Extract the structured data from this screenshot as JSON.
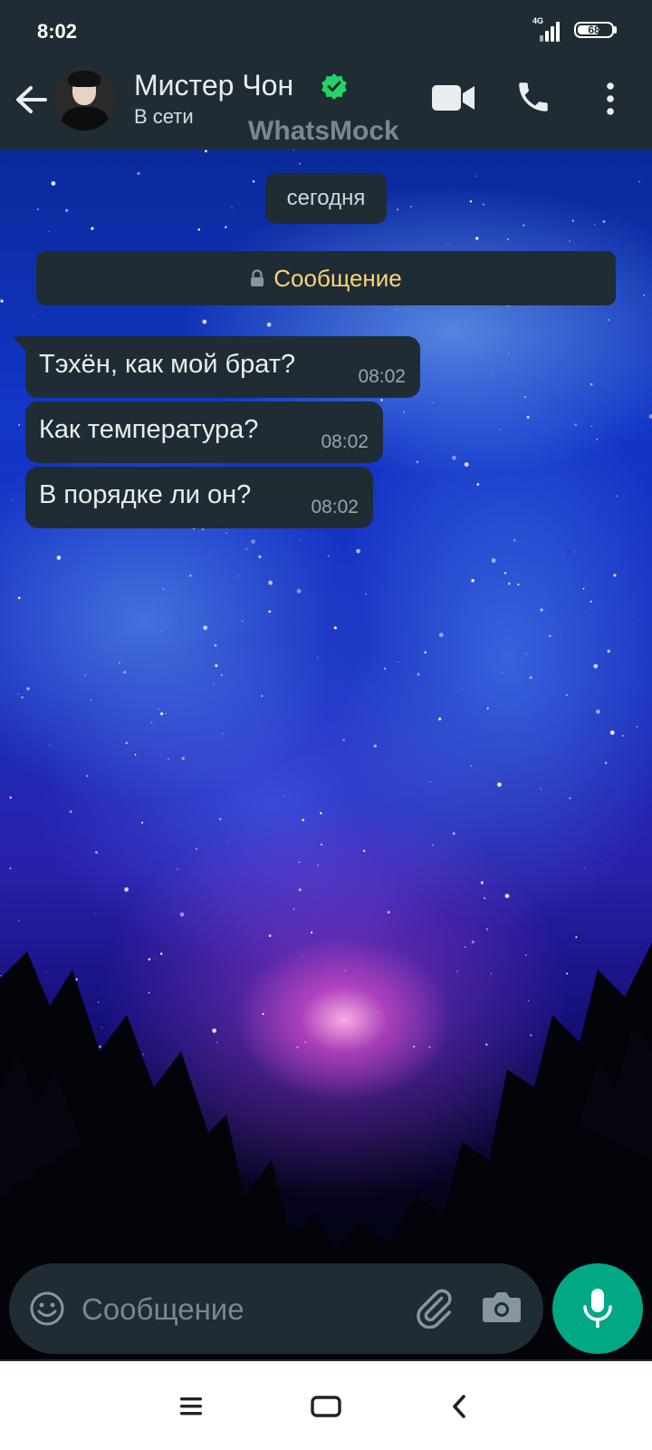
{
  "status_bar": {
    "time": "8:02",
    "network": "4G",
    "battery": "68"
  },
  "header": {
    "contact_name": "Мистер Чон",
    "status": "В сети",
    "watermark": "WhatsMock",
    "verified_color": "#25d366"
  },
  "chat": {
    "date_chip": "сегодня",
    "notice": "Сообщение",
    "messages": [
      {
        "text": "Тэхён, как мой брат?",
        "time": "08:02"
      },
      {
        "text": "Как температура?",
        "time": "08:02"
      },
      {
        "text": "В порядке ли он?",
        "time": "08:02"
      }
    ]
  },
  "composer": {
    "placeholder": "Сообщение"
  },
  "colors": {
    "bar_bg": "#1f2c34",
    "accent": "#00a884",
    "notice_text": "#ffd279"
  },
  "icons": {
    "back": "arrow-left-icon",
    "verified": "verified-badge-icon",
    "video": "video-camera-icon",
    "call": "phone-icon",
    "menu": "more-vertical-icon",
    "lock": "lock-icon",
    "emoji": "emoji-icon",
    "attach": "paperclip-icon",
    "camera": "camera-icon",
    "mic": "microphone-icon",
    "nav_recents": "menu-lines-icon",
    "nav_home": "home-square-icon",
    "nav_back": "chevron-left-icon"
  }
}
